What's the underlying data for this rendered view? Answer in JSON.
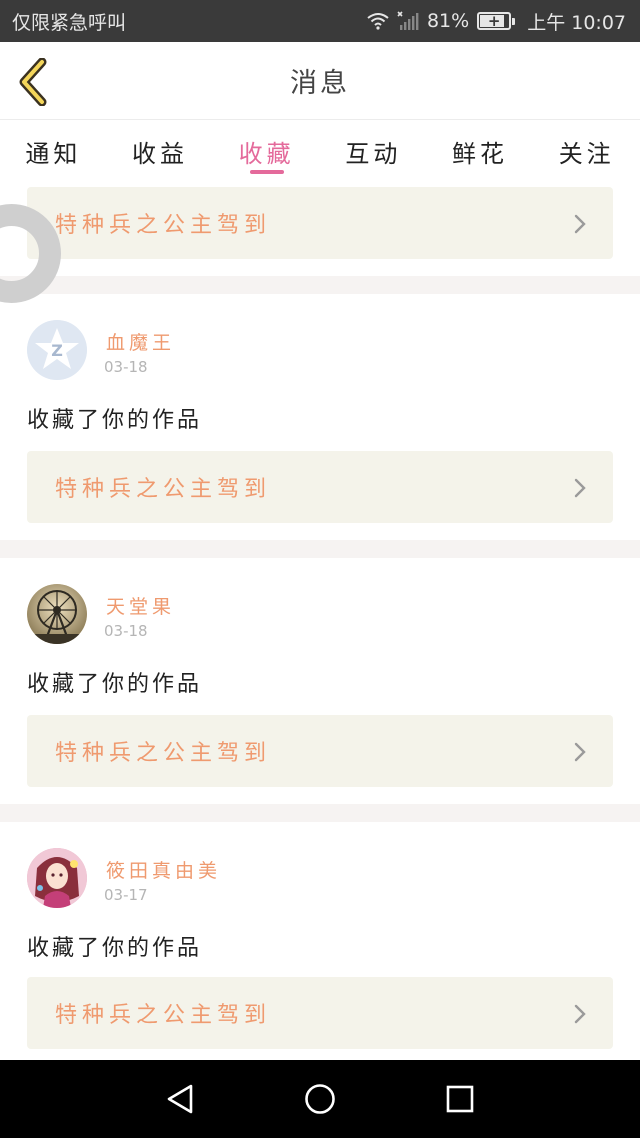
{
  "status_bar": {
    "left_text": "仅限紧急呼叫",
    "battery": "81%",
    "time": "上午 10:07",
    "icons": [
      "wifi-icon",
      "signal-icon",
      "battery-icon"
    ]
  },
  "header": {
    "title": "消息",
    "back_icon": "chevron-left-icon"
  },
  "tabs": [
    {
      "label": "通知",
      "active": false
    },
    {
      "label": "收益",
      "active": false
    },
    {
      "label": "收藏",
      "active": true
    },
    {
      "label": "互动",
      "active": false
    },
    {
      "label": "鲜花",
      "active": false
    },
    {
      "label": "关注",
      "active": false
    }
  ],
  "messages": [
    {
      "username": "",
      "date": "",
      "text": "",
      "work_title": "特种兵之公主驾到"
    },
    {
      "username": "血魔王",
      "date": "03-18",
      "text": "收藏了你的作品",
      "work_title": "特种兵之公主驾到",
      "avatar": "qq-default-avatar"
    },
    {
      "username": "天堂果",
      "date": "03-18",
      "text": "收藏了你的作品",
      "work_title": "特种兵之公主驾到",
      "avatar": "ferris-wheel-avatar"
    },
    {
      "username": "筱田真由美",
      "date": "03-17",
      "text": "收藏了你的作品",
      "work_title": "特种兵之公主驾到",
      "avatar": "anime-girl-avatar"
    }
  ],
  "colors": {
    "accent_pink": "#e46a9b",
    "accent_orange": "#ef9a6f",
    "card_bg": "#f4f3ea"
  }
}
